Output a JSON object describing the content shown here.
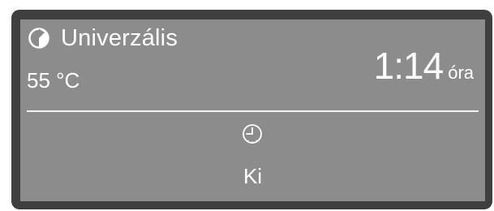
{
  "program": {
    "icon": "half-circle-program-icon",
    "name": "Univerzális",
    "temperature": "55 °C"
  },
  "duration": {
    "value": "1:14",
    "unit": "óra"
  },
  "timer": {
    "icon": "clock-icon",
    "status": "Ki"
  },
  "colors": {
    "frame": "#3f3f3f",
    "screen": "#8c8c8c",
    "text": "#ffffff"
  }
}
